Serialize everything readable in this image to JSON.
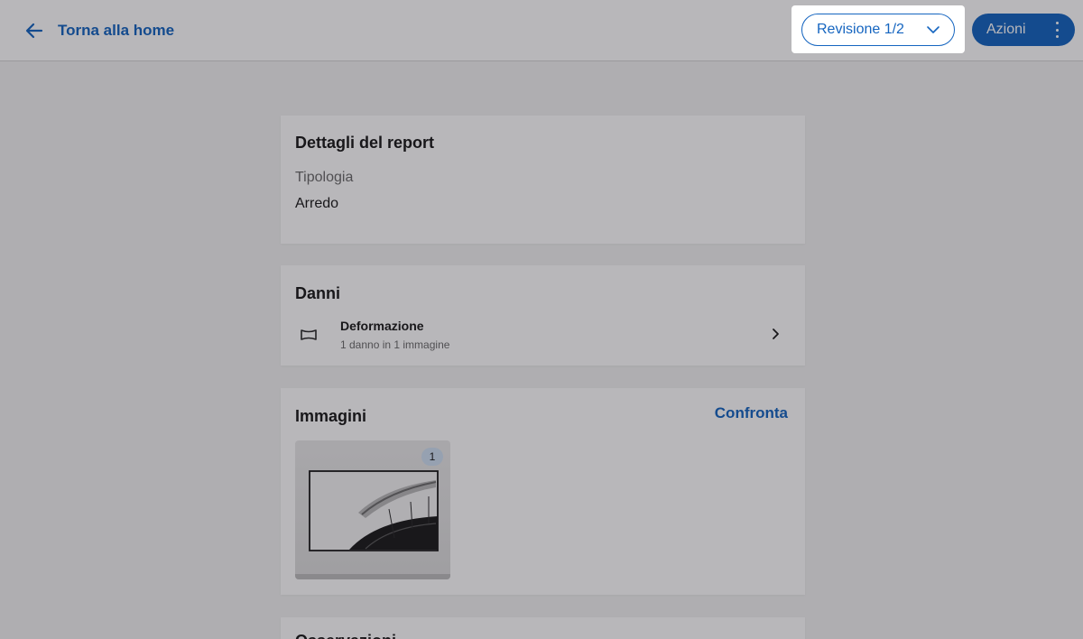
{
  "header": {
    "back_label": "Torna alla home",
    "revision_label": "Revisione 1/2",
    "actions_label": "Azioni"
  },
  "details_card": {
    "title": "Dettagli del report",
    "field_label": "Tipologia",
    "field_value": "Arredo"
  },
  "damages_card": {
    "title": "Danni",
    "items": [
      {
        "name": "Deformazione",
        "subtitle": "1 danno in 1 immagine",
        "icon": "deformation-icon"
      }
    ]
  },
  "images_card": {
    "title": "Immagini",
    "compare_label": "Confronta",
    "thumbnails": [
      {
        "badge": "1"
      }
    ]
  },
  "notes_card": {
    "title": "Osservazioni"
  },
  "colors": {
    "accent": "#1565c0",
    "background": "#f2f2f2",
    "card": "#ffffff",
    "badge": "#cfe0f3"
  }
}
